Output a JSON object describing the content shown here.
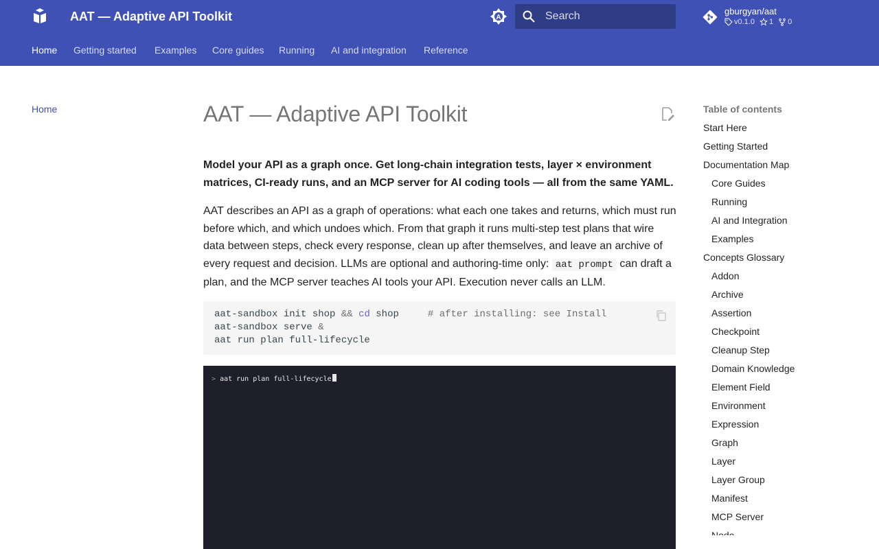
{
  "header": {
    "title": "AAT — Adaptive API Toolkit",
    "search_placeholder": "Search",
    "repo": {
      "name": "gburgyan/aat",
      "version": "v0.1.0",
      "stars": "1",
      "forks": "0"
    }
  },
  "tabs": [
    {
      "label": "Home",
      "active": true
    },
    {
      "label": "Getting started"
    },
    {
      "label": "Examples"
    },
    {
      "label": "Core guides"
    },
    {
      "label": "Running"
    },
    {
      "label": "AI and integration"
    },
    {
      "label": "Reference"
    }
  ],
  "sidebar": {
    "home": "Home"
  },
  "content": {
    "title": "AAT — Adaptive API Toolkit",
    "lead": "Model your API as a graph once. Get long-chain integration tests, layer × environment matrices, CI-ready runs, and an MCP server for AI coding tools — all from the same YAML.",
    "para_part1": "AAT describes an API as a graph of operations: what each one takes and returns, which must run before which, and which undoes which. From that graph it runs multi-step test plans that wire data between steps, check every response, clean up after themselves, and leave an archive of every request and decision. LLMs are optional and authoring-time only: ",
    "para_code": "aat prompt",
    "para_part2": " can draft a plan, and the MCP server teaches AI tools your API. Execution never calls an LLM.",
    "code": {
      "line1_cmd1": "aat-sandbox init shop ",
      "line1_op": "&&",
      "line1_kw": "cd",
      "line1_arg": " shop",
      "line1_comment": "# after installing: see Install",
      "line2_cmd": "aat-sandbox serve ",
      "line2_op": "&",
      "line3_cmd": "aat run plan full-lifecycle"
    },
    "terminal": {
      "prompt": ">",
      "command": "aat run plan full-lifecycle"
    }
  },
  "toc": {
    "title": "Table of contents",
    "items": [
      {
        "label": "Start Here",
        "level": 1
      },
      {
        "label": "Getting Started",
        "level": 1
      },
      {
        "label": "Documentation Map",
        "level": 1
      },
      {
        "label": "Core Guides",
        "level": 2
      },
      {
        "label": "Running",
        "level": 2
      },
      {
        "label": "AI and Integration",
        "level": 2
      },
      {
        "label": "Examples",
        "level": 2
      },
      {
        "label": "Concepts Glossary",
        "level": 1
      },
      {
        "label": "Addon",
        "level": 2
      },
      {
        "label": "Archive",
        "level": 2
      },
      {
        "label": "Assertion",
        "level": 2
      },
      {
        "label": "Checkpoint",
        "level": 2
      },
      {
        "label": "Cleanup Step",
        "level": 2
      },
      {
        "label": "Domain Knowledge",
        "level": 2
      },
      {
        "label": "Element Field",
        "level": 2
      },
      {
        "label": "Environment",
        "level": 2
      },
      {
        "label": "Expression",
        "level": 2
      },
      {
        "label": "Graph",
        "level": 2
      },
      {
        "label": "Layer",
        "level": 2
      },
      {
        "label": "Layer Group",
        "level": 2
      },
      {
        "label": "Manifest",
        "level": 2
      },
      {
        "label": "MCP Server",
        "level": 2
      },
      {
        "label": "Node",
        "level": 2
      }
    ]
  },
  "colors": {
    "primary": "#4051b5",
    "terminal_bg": "#1f1f2c",
    "code_bg": "#f5f5f5"
  }
}
